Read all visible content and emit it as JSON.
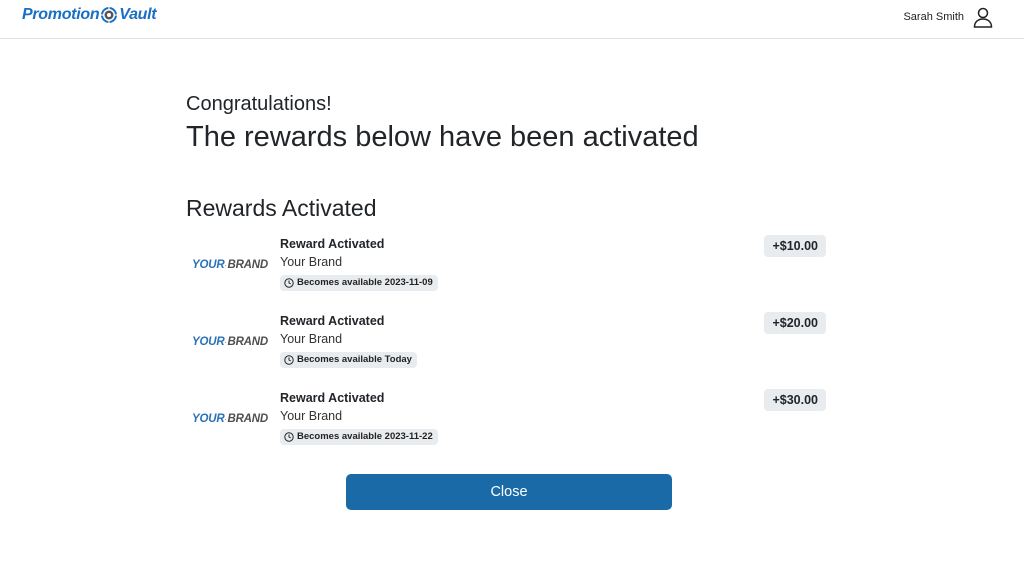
{
  "header": {
    "logo_left": "Promotion",
    "logo_right": "Vault",
    "user_name": "Sarah Smith"
  },
  "main": {
    "congrats": "Congratulations!",
    "headline": "The rewards below have been activated",
    "section_title": "Rewards Activated",
    "rewards": [
      {
        "logo_your": "YOUR",
        "logo_brand": "BRAND",
        "title": "Reward Activated",
        "brand": "Your Brand",
        "availability": "Becomes available 2023-11-09",
        "amount": "+$10.00"
      },
      {
        "logo_your": "YOUR",
        "logo_brand": "BRAND",
        "title": "Reward Activated",
        "brand": "Your Brand",
        "availability": "Becomes available Today",
        "amount": "+$20.00"
      },
      {
        "logo_your": "YOUR",
        "logo_brand": "BRAND",
        "title": "Reward Activated",
        "brand": "Your Brand",
        "availability": "Becomes available 2023-11-22",
        "amount": "+$30.00"
      }
    ],
    "close_label": "Close"
  },
  "colors": {
    "brand_blue": "#1a6fc4",
    "button_blue": "#1b6aa8",
    "badge_bg": "#e9ecef"
  },
  "icons": [
    "vault-icon",
    "user-icon",
    "clock-icon",
    "brand-mark-icon"
  ]
}
